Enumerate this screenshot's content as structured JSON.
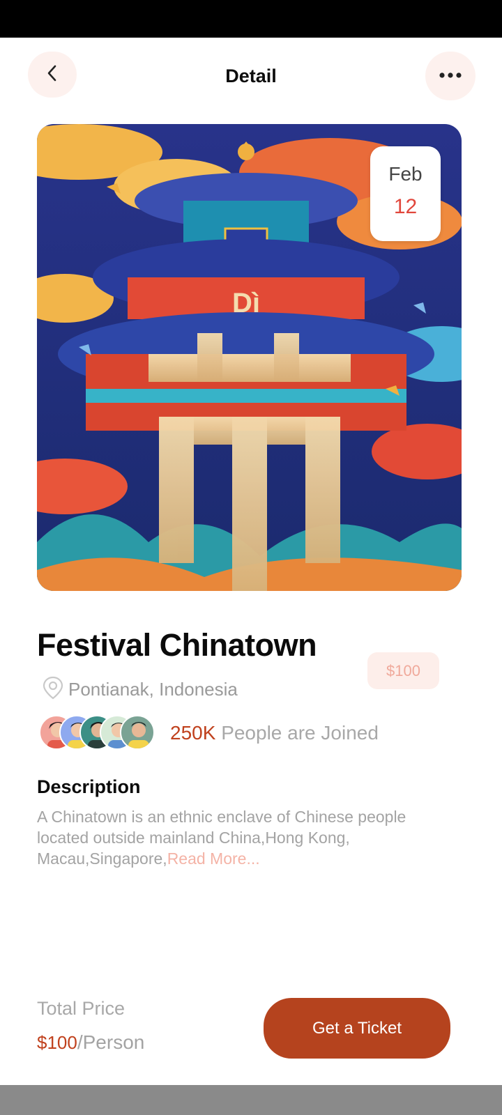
{
  "header": {
    "title": "Detail",
    "back_icon": "chevron-left-icon",
    "more_icon": "more-horizontal-icon"
  },
  "hero": {
    "date_month": "Feb",
    "date_day": "12",
    "poster_text": "Dì"
  },
  "event": {
    "title": "Festival Chinatown",
    "location": "Pontianak, Indonesia",
    "price_badge": "$100",
    "joined_count": "250K",
    "joined_text": "People are Joined"
  },
  "description": {
    "heading": "Description",
    "body": "A Chinatown is an ethnic enclave of Chinese people located outside mainland China,Hong Kong, Macau,Singapore,",
    "read_more": "Read More..."
  },
  "footer": {
    "total_label": "Total Price",
    "total_amount": "$100",
    "total_unit": "/Person",
    "cta_label": "Get a Ticket"
  },
  "colors": {
    "accent": "#b5431e",
    "accent_light": "#fdeeea",
    "muted_text": "#a3a3a3"
  }
}
